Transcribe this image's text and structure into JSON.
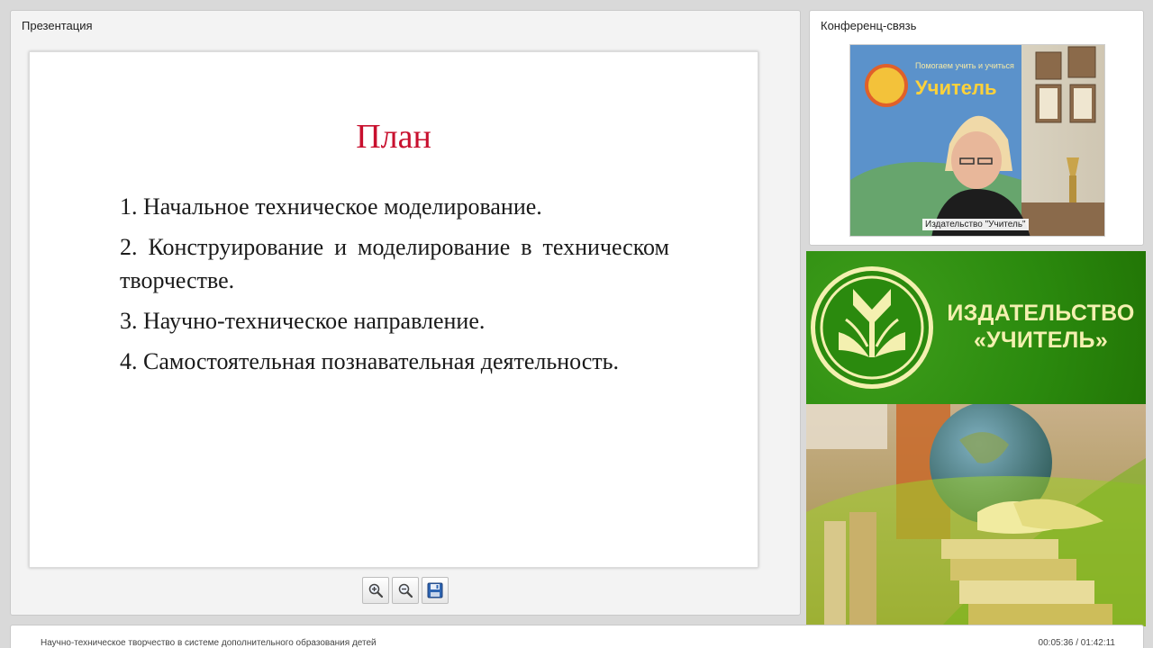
{
  "presentation": {
    "panel_title": "Презентация",
    "slide": {
      "title": "План",
      "items": [
        "1. Начальное техническое моделирование.",
        "2. Конструирование и моделирование в техническом творчестве.",
        "3. Научно-техническое направление.",
        "4. Самостоятельная познавательная деятельность."
      ]
    },
    "toolbar": {
      "zoom_in_icon": "zoom-in-icon",
      "zoom_out_icon": "zoom-out-icon",
      "save_icon": "save-icon"
    }
  },
  "conference": {
    "panel_title": "Конференц-связь",
    "video_caption": "Издательство \"Учитель\"",
    "poster_text": {
      "line1": "Помогаем учить и учиться",
      "line2": "Учитель"
    }
  },
  "banner": {
    "publisher_line1": "ИЗДАТЕЛЬСТВО",
    "publisher_line2": "«УЧИТЕЛЬ»"
  },
  "footer": {
    "title": "Научно-техническое творчество в системе дополнительного образования детей",
    "time": "00:05:36 / 01:42:11"
  },
  "colors": {
    "slide_title": "#c8102e",
    "banner_green": "#2b8a0e",
    "banner_text": "#f4f0b0"
  }
}
